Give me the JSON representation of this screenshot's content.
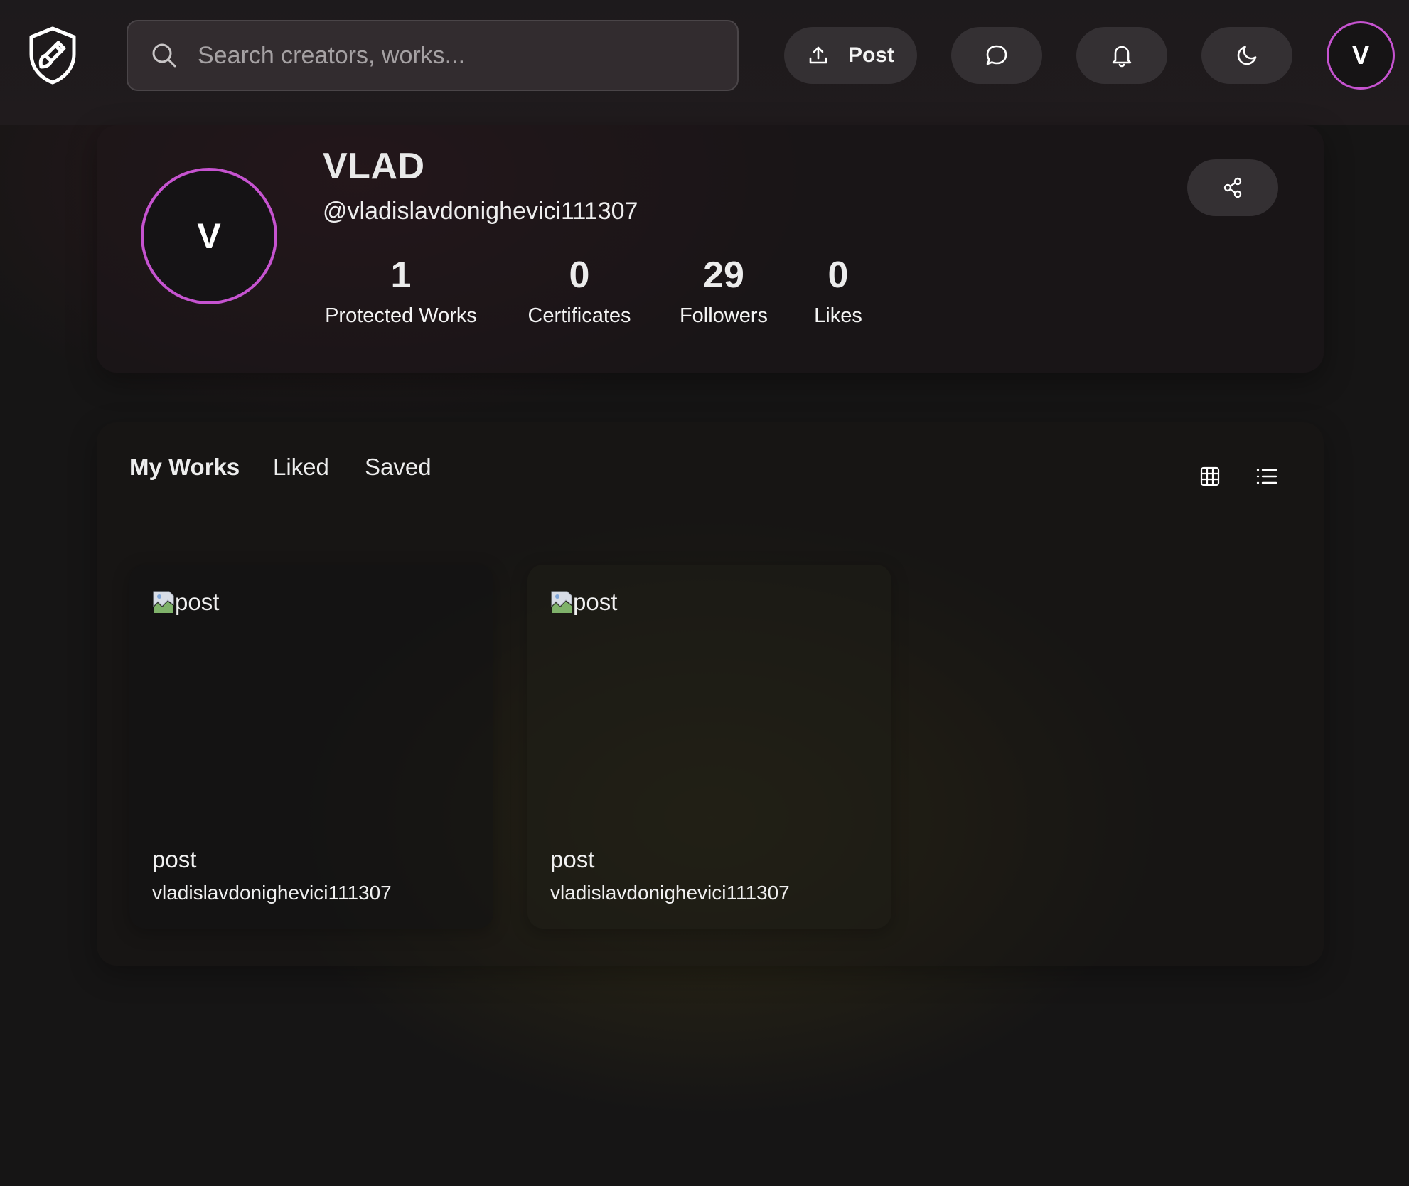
{
  "header": {
    "search": {
      "placeholder": "Search creators, works...",
      "value": ""
    },
    "post_label": "Post",
    "avatar_initial": "V",
    "icons": [
      "shield-brush-logo-icon",
      "search-icon",
      "upload-icon",
      "chat-icon",
      "bell-icon",
      "moon-icon"
    ]
  },
  "profile": {
    "avatar_initial": "V",
    "name": "VLAD",
    "handle": "@vladislavdonighevici111307",
    "stats": [
      {
        "value": "1",
        "label": "Protected Works"
      },
      {
        "value": "0",
        "label": "Certificates"
      },
      {
        "value": "29",
        "label": "Followers"
      },
      {
        "value": "0",
        "label": "Likes"
      }
    ]
  },
  "tabs": [
    {
      "label": "My Works",
      "active": true
    },
    {
      "label": "Liked",
      "active": false
    },
    {
      "label": "Saved",
      "active": false
    }
  ],
  "view_modes": [
    "grid-icon",
    "list-icon"
  ],
  "posts": [
    {
      "alt": "post",
      "title": "post",
      "author": "vladislavdonighevici111307"
    },
    {
      "alt": "post",
      "title": "post",
      "author": "vladislavdonighevici111307"
    }
  ],
  "colors": {
    "accent_ring": "#c653d0",
    "button_bg": "#343033",
    "page_bg": "#161515"
  }
}
